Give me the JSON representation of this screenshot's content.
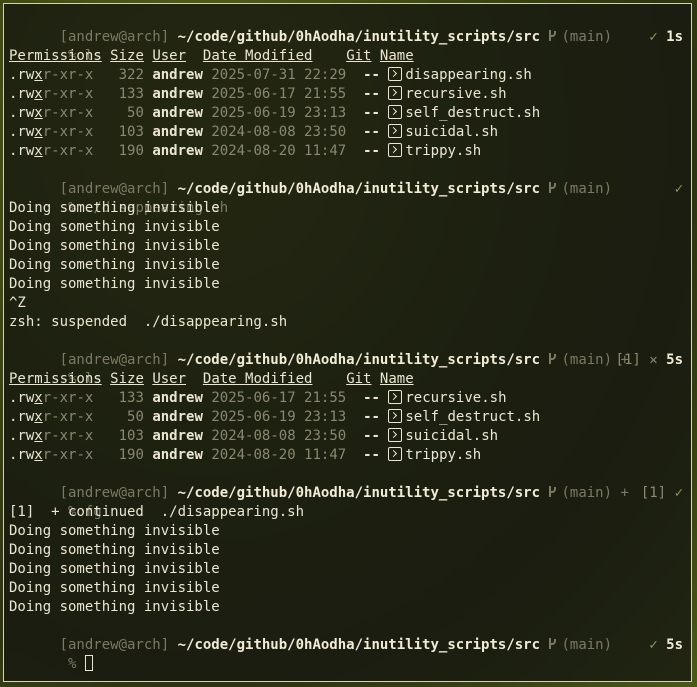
{
  "prompt": {
    "user_host": "[andrew@arch]",
    "cwd": "~/code/github/0hAodha/inutility_scripts/src",
    "branch": "(main)",
    "dirty_marker": "+",
    "symbol": "%"
  },
  "ls_headers": {
    "permissions": "Permissions",
    "size": "Size",
    "user": "User",
    "date": "Date Modified",
    "git": "Git",
    "name": "Name"
  },
  "ls_block_1": {
    "command": "ls",
    "status_icon": "✓",
    "duration": "1s",
    "rows": [
      {
        "perm_dot": ".",
        "perm_rw": "rw",
        "perm_x": "x",
        "perm_rest": "r-xr-x",
        "size": "322",
        "user": "andrew",
        "date": "2025-07-31 22:29",
        "git": "--",
        "name": "disappearing.sh"
      },
      {
        "perm_dot": ".",
        "perm_rw": "rw",
        "perm_x": "x",
        "perm_rest": "r-xr-x",
        "size": "133",
        "user": "andrew",
        "date": "2025-06-17 21:55",
        "git": "--",
        "name": "recursive.sh"
      },
      {
        "perm_dot": ".",
        "perm_rw": "rw",
        "perm_x": "x",
        "perm_rest": "r-xr-x",
        "size": "50",
        "user": "andrew",
        "date": "2025-06-19 23:13",
        "git": "--",
        "name": "self_destruct.sh"
      },
      {
        "perm_dot": ".",
        "perm_rw": "rw",
        "perm_x": "x",
        "perm_rest": "r-xr-x",
        "size": "103",
        "user": "andrew",
        "date": "2024-08-08 23:50",
        "git": "--",
        "name": "suicidal.sh"
      },
      {
        "perm_dot": ".",
        "perm_rw": "rw",
        "perm_x": "x",
        "perm_rest": "r-xr-x",
        "size": "190",
        "user": "andrew",
        "date": "2024-08-20 11:47",
        "git": "--",
        "name": "trippy.sh"
      }
    ]
  },
  "run_block": {
    "command": "./disappearing.sh",
    "status_icon": "✓",
    "output": [
      "Doing something invisible",
      "Doing something invisible",
      "Doing something invisible",
      "Doing something invisible",
      "Doing something invisible"
    ],
    "ctrl_z": "^Z",
    "suspended": "zsh: suspended  ./disappearing.sh"
  },
  "ls_block_2": {
    "command": "ls",
    "jobs": "[1]",
    "status_icon": "✕",
    "duration": "5s",
    "rows": [
      {
        "perm_dot": ".",
        "perm_rw": "rw",
        "perm_x": "x",
        "perm_rest": "r-xr-x",
        "size": "133",
        "user": "andrew",
        "date": "2025-06-17 21:55",
        "git": "--",
        "name": "recursive.sh"
      },
      {
        "perm_dot": ".",
        "perm_rw": "rw",
        "perm_x": "x",
        "perm_rest": "r-xr-x",
        "size": "50",
        "user": "andrew",
        "date": "2025-06-19 23:13",
        "git": "--",
        "name": "self_destruct.sh"
      },
      {
        "perm_dot": ".",
        "perm_rw": "rw",
        "perm_x": "x",
        "perm_rest": "r-xr-x",
        "size": "103",
        "user": "andrew",
        "date": "2024-08-08 23:50",
        "git": "--",
        "name": "suicidal.sh"
      },
      {
        "perm_dot": ".",
        "perm_rw": "rw",
        "perm_x": "x",
        "perm_rest": "r-xr-x",
        "size": "190",
        "user": "andrew",
        "date": "2024-08-20 11:47",
        "git": "--",
        "name": "trippy.sh"
      }
    ]
  },
  "fg_block": {
    "command": "fg",
    "jobs": "[1]",
    "continued": "[1]  + continued  ./disappearing.sh",
    "output": [
      "Doing something invisible",
      "Doing something invisible",
      "Doing something invisible",
      "Doing something invisible",
      "Doing something invisible"
    ]
  },
  "final_prompt": {
    "status_icon": "✓",
    "duration": "5s"
  },
  "icons": {
    "file": "file-script-icon",
    "branch": "git-branch-icon",
    "check": "check-icon",
    "cross": "cross-icon"
  }
}
